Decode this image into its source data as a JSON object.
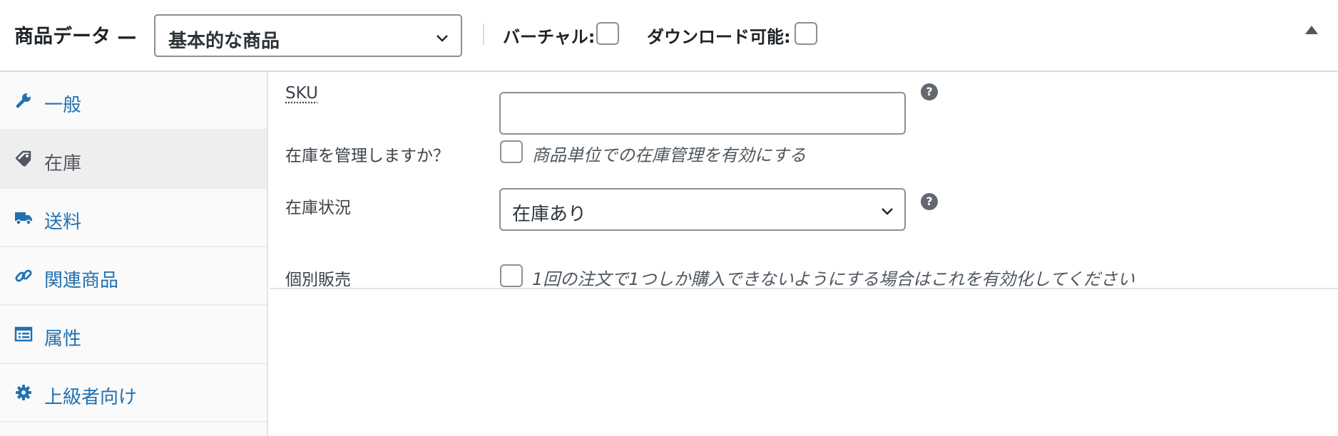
{
  "header": {
    "title": "商品データ —",
    "product_type": {
      "selected": "基本的な商品"
    },
    "virtual_label": "バーチャル:",
    "virtual_checked": false,
    "downloadable_label": "ダウンロード可能:",
    "downloadable_checked": false,
    "collapse_icon": "triangle-up-icon"
  },
  "sidebar": {
    "tabs": [
      {
        "label": "一般",
        "icon": "wrench-icon",
        "active": false
      },
      {
        "label": "在庫",
        "icon": "tag-icon",
        "active": true
      },
      {
        "label": "送料",
        "icon": "truck-icon",
        "active": false
      },
      {
        "label": "関連商品",
        "icon": "link-icon",
        "active": false
      },
      {
        "label": "属性",
        "icon": "list-icon",
        "active": false
      },
      {
        "label": "上級者向け",
        "icon": "gear-icon",
        "active": false
      }
    ]
  },
  "inventory": {
    "sku": {
      "label": "SKU",
      "value": "",
      "help_icon": "help-icon"
    },
    "manage_stock": {
      "label": "在庫を管理しますか？",
      "description": "商品単位での在庫管理を有効にする",
      "checked": false
    },
    "stock_status": {
      "label": "在庫状況",
      "selected": "在庫あり",
      "help_icon": "help-icon"
    },
    "sold_individually": {
      "label": "個別販売",
      "description": "1回の注文で1つしか購入できないようにする場合はこれを有効化してください",
      "checked": false
    }
  },
  "colors": {
    "link": "#2271b1",
    "active_tab_bg": "#eeeeee",
    "border": "#8c8f94",
    "help_icon": "#646970"
  }
}
